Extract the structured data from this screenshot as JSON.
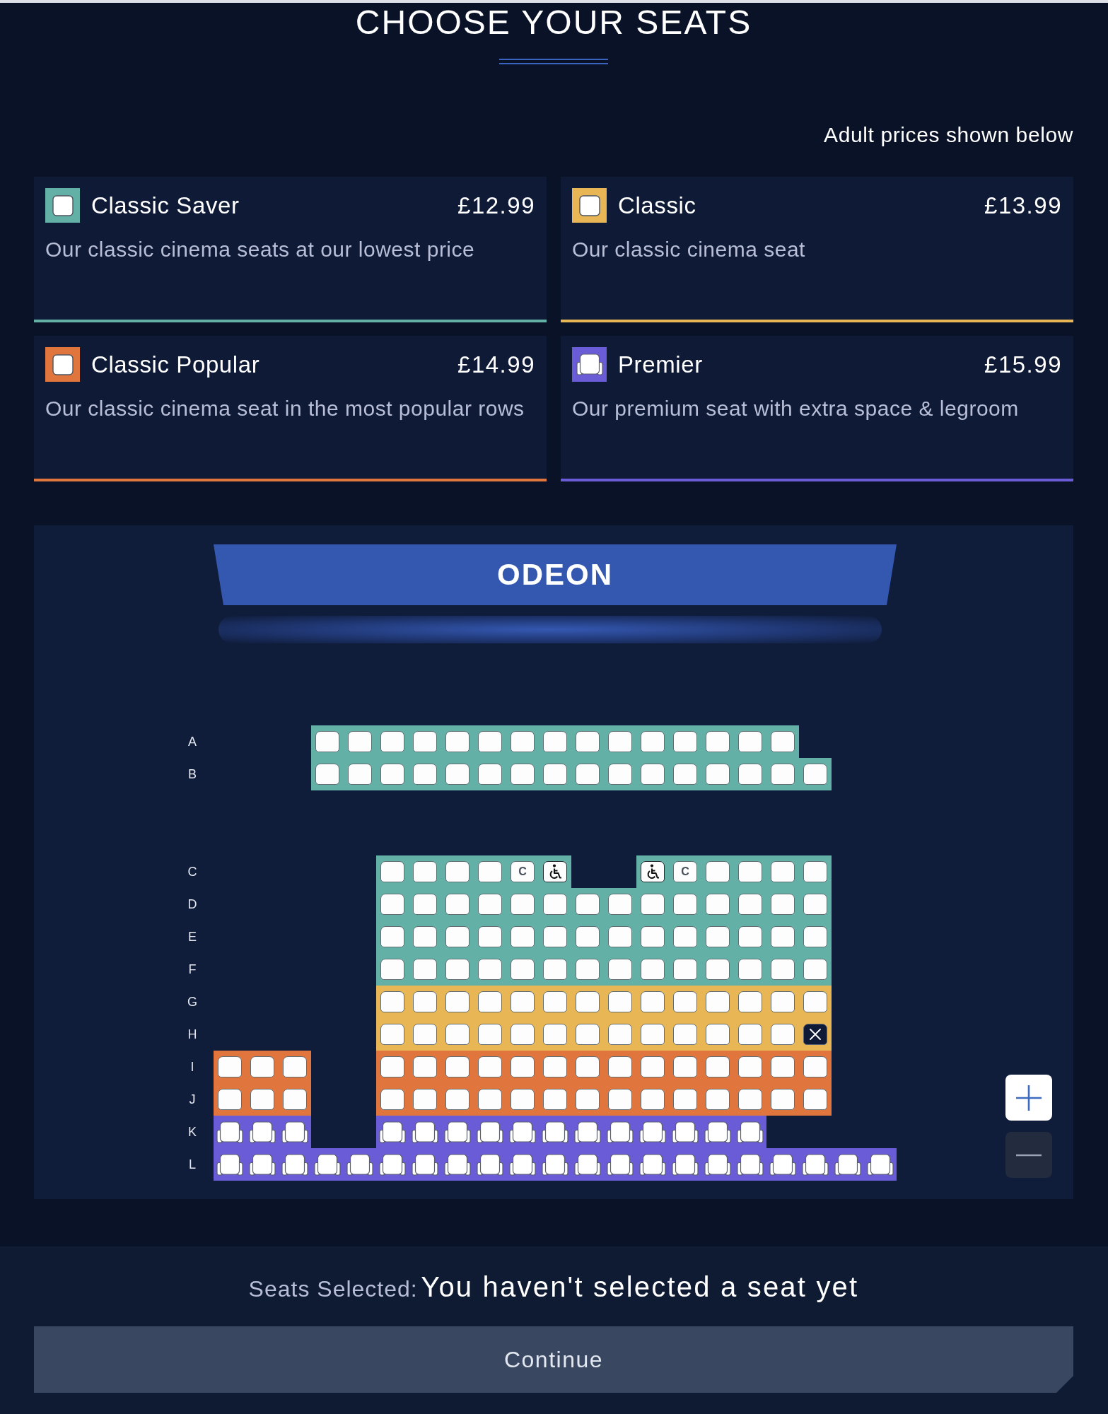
{
  "page": {
    "title": "CHOOSE YOUR SEATS",
    "price_note": "Adult prices shown below"
  },
  "tiers": [
    {
      "kind": "standard",
      "name": "Classic Saver",
      "price": "£12.99",
      "description": "Our classic cinema seats at our lowest price",
      "color": "#63b0a7"
    },
    {
      "kind": "standard",
      "name": "Classic",
      "price": "£13.99",
      "description": "Our classic cinema seat",
      "color": "#e8b654"
    },
    {
      "kind": "standard",
      "name": "Classic Popular",
      "price": "£14.99",
      "description": "Our classic cinema seat in the most popular rows",
      "color": "#e0763e"
    },
    {
      "kind": "premier",
      "name": "Premier",
      "price": "£15.99",
      "description": "Our premium seat with extra space & legroom",
      "color": "#6a5bd6"
    }
  ],
  "seat_map": {
    "screen": {
      "label": "ODEON"
    },
    "rows": [
      {
        "kind": "row",
        "label": "A",
        "color": "#63b0a7",
        "seats": [
          {
            "kind": "space"
          },
          {
            "kind": "space"
          },
          {
            "kind": "space"
          },
          {
            "kind": "standard",
            "selected": false
          },
          {
            "kind": "standard",
            "selected": false
          },
          {
            "kind": "standard",
            "selected": false
          },
          {
            "kind": "standard",
            "selected": false
          },
          {
            "kind": "standard",
            "selected": false
          },
          {
            "kind": "standard",
            "selected": false
          },
          {
            "kind": "standard",
            "selected": false
          },
          {
            "kind": "standard",
            "selected": false
          },
          {
            "kind": "standard",
            "selected": false
          },
          {
            "kind": "standard",
            "selected": false
          },
          {
            "kind": "standard",
            "selected": false
          },
          {
            "kind": "standard",
            "selected": false
          },
          {
            "kind": "standard",
            "selected": false
          },
          {
            "kind": "standard",
            "selected": false
          },
          {
            "kind": "standard",
            "selected": false
          }
        ]
      },
      {
        "kind": "row",
        "label": "B",
        "color": "#63b0a7",
        "seats": [
          {
            "kind": "space"
          },
          {
            "kind": "space"
          },
          {
            "kind": "space"
          },
          {
            "kind": "standard",
            "selected": false
          },
          {
            "kind": "standard",
            "selected": false
          },
          {
            "kind": "standard",
            "selected": false
          },
          {
            "kind": "standard",
            "selected": false
          },
          {
            "kind": "standard",
            "selected": false
          },
          {
            "kind": "standard",
            "selected": false
          },
          {
            "kind": "standard",
            "selected": false
          },
          {
            "kind": "standard",
            "selected": false
          },
          {
            "kind": "standard",
            "selected": false
          },
          {
            "kind": "standard",
            "selected": false
          },
          {
            "kind": "standard",
            "selected": false
          },
          {
            "kind": "standard",
            "selected": false
          },
          {
            "kind": "standard",
            "selected": false
          },
          {
            "kind": "standard",
            "selected": false
          },
          {
            "kind": "standard",
            "selected": false
          },
          {
            "kind": "standard",
            "selected": false
          }
        ]
      },
      {
        "kind": "aisle"
      },
      {
        "kind": "aisle"
      },
      {
        "kind": "row",
        "label": "C",
        "color": "#63b0a7",
        "seats": [
          {
            "kind": "space"
          },
          {
            "kind": "space"
          },
          {
            "kind": "space"
          },
          {
            "kind": "space"
          },
          {
            "kind": "space"
          },
          {
            "kind": "standard",
            "selected": false
          },
          {
            "kind": "standard",
            "selected": false
          },
          {
            "kind": "standard",
            "selected": false
          },
          {
            "kind": "standard",
            "selected": false
          },
          {
            "kind": "companion",
            "label": "C",
            "selected": false
          },
          {
            "kind": "wheelchair",
            "selected": false
          },
          {
            "kind": "space"
          },
          {
            "kind": "space"
          },
          {
            "kind": "wheelchair",
            "selected": false
          },
          {
            "kind": "companion",
            "label": "C",
            "selected": false
          },
          {
            "kind": "standard",
            "selected": false
          },
          {
            "kind": "standard",
            "selected": false
          },
          {
            "kind": "standard",
            "selected": false
          },
          {
            "kind": "standard",
            "selected": false
          }
        ]
      },
      {
        "kind": "row",
        "label": "D",
        "color": "#63b0a7",
        "seats": [
          {
            "kind": "space"
          },
          {
            "kind": "space"
          },
          {
            "kind": "space"
          },
          {
            "kind": "space"
          },
          {
            "kind": "space"
          },
          {
            "kind": "standard",
            "selected": false
          },
          {
            "kind": "standard",
            "selected": false
          },
          {
            "kind": "standard",
            "selected": false
          },
          {
            "kind": "standard",
            "selected": false
          },
          {
            "kind": "standard",
            "selected": false
          },
          {
            "kind": "standard",
            "selected": false
          },
          {
            "kind": "standard",
            "selected": false
          },
          {
            "kind": "standard",
            "selected": false
          },
          {
            "kind": "standard",
            "selected": false
          },
          {
            "kind": "standard",
            "selected": false
          },
          {
            "kind": "standard",
            "selected": false
          },
          {
            "kind": "standard",
            "selected": false
          },
          {
            "kind": "standard",
            "selected": false
          },
          {
            "kind": "standard",
            "selected": false
          }
        ]
      },
      {
        "kind": "row",
        "label": "E",
        "color": "#63b0a7",
        "seats": [
          {
            "kind": "space"
          },
          {
            "kind": "space"
          },
          {
            "kind": "space"
          },
          {
            "kind": "space"
          },
          {
            "kind": "space"
          },
          {
            "kind": "standard",
            "selected": false
          },
          {
            "kind": "standard",
            "selected": false
          },
          {
            "kind": "standard",
            "selected": false
          },
          {
            "kind": "standard",
            "selected": false
          },
          {
            "kind": "standard",
            "selected": false
          },
          {
            "kind": "standard",
            "selected": false
          },
          {
            "kind": "standard",
            "selected": false
          },
          {
            "kind": "standard",
            "selected": false
          },
          {
            "kind": "standard",
            "selected": false
          },
          {
            "kind": "standard",
            "selected": false
          },
          {
            "kind": "standard",
            "selected": false
          },
          {
            "kind": "standard",
            "selected": false
          },
          {
            "kind": "standard",
            "selected": false
          },
          {
            "kind": "standard",
            "selected": false
          }
        ]
      },
      {
        "kind": "row",
        "label": "F",
        "color": "#63b0a7",
        "seats": [
          {
            "kind": "space"
          },
          {
            "kind": "space"
          },
          {
            "kind": "space"
          },
          {
            "kind": "space"
          },
          {
            "kind": "space"
          },
          {
            "kind": "standard",
            "selected": false
          },
          {
            "kind": "standard",
            "selected": false
          },
          {
            "kind": "standard",
            "selected": false
          },
          {
            "kind": "standard",
            "selected": false
          },
          {
            "kind": "standard",
            "selected": false
          },
          {
            "kind": "standard",
            "selected": false
          },
          {
            "kind": "standard",
            "selected": false
          },
          {
            "kind": "standard",
            "selected": false
          },
          {
            "kind": "standard",
            "selected": false
          },
          {
            "kind": "standard",
            "selected": false
          },
          {
            "kind": "standard",
            "selected": false
          },
          {
            "kind": "standard",
            "selected": false
          },
          {
            "kind": "standard",
            "selected": false
          },
          {
            "kind": "standard",
            "selected": false
          }
        ]
      },
      {
        "kind": "row",
        "label": "G",
        "color": "#e8b654",
        "seats": [
          {
            "kind": "space"
          },
          {
            "kind": "space"
          },
          {
            "kind": "space"
          },
          {
            "kind": "space"
          },
          {
            "kind": "space"
          },
          {
            "kind": "standard",
            "selected": false
          },
          {
            "kind": "standard",
            "selected": false
          },
          {
            "kind": "standard",
            "selected": false
          },
          {
            "kind": "standard",
            "selected": false
          },
          {
            "kind": "standard",
            "selected": false
          },
          {
            "kind": "standard",
            "selected": false
          },
          {
            "kind": "standard",
            "selected": false
          },
          {
            "kind": "standard",
            "selected": false
          },
          {
            "kind": "standard",
            "selected": false
          },
          {
            "kind": "standard",
            "selected": false
          },
          {
            "kind": "standard",
            "selected": false
          },
          {
            "kind": "standard",
            "selected": false
          },
          {
            "kind": "standard",
            "selected": false
          },
          {
            "kind": "standard",
            "selected": false
          }
        ]
      },
      {
        "kind": "row",
        "label": "H",
        "color": "#e8b654",
        "seats": [
          {
            "kind": "space"
          },
          {
            "kind": "space"
          },
          {
            "kind": "space"
          },
          {
            "kind": "space"
          },
          {
            "kind": "space"
          },
          {
            "kind": "standard",
            "selected": false
          },
          {
            "kind": "standard",
            "selected": false
          },
          {
            "kind": "standard",
            "selected": false
          },
          {
            "kind": "standard",
            "selected": false
          },
          {
            "kind": "standard",
            "selected": false
          },
          {
            "kind": "standard",
            "selected": false
          },
          {
            "kind": "standard",
            "selected": false
          },
          {
            "kind": "standard",
            "selected": false
          },
          {
            "kind": "standard",
            "selected": false
          },
          {
            "kind": "standard",
            "selected": false
          },
          {
            "kind": "standard",
            "selected": false
          },
          {
            "kind": "standard",
            "selected": false
          },
          {
            "kind": "standard",
            "selected": false
          },
          {
            "kind": "unavailable",
            "selected": false
          }
        ]
      },
      {
        "kind": "row",
        "label": "I",
        "color": "#e0763e",
        "seats": [
          {
            "kind": "standard",
            "selected": false
          },
          {
            "kind": "standard",
            "selected": false
          },
          {
            "kind": "standard",
            "selected": false
          },
          {
            "kind": "space"
          },
          {
            "kind": "space"
          },
          {
            "kind": "standard",
            "selected": false
          },
          {
            "kind": "standard",
            "selected": false
          },
          {
            "kind": "standard",
            "selected": false
          },
          {
            "kind": "standard",
            "selected": false
          },
          {
            "kind": "standard",
            "selected": false
          },
          {
            "kind": "standard",
            "selected": false
          },
          {
            "kind": "standard",
            "selected": false
          },
          {
            "kind": "standard",
            "selected": false
          },
          {
            "kind": "standard",
            "selected": false
          },
          {
            "kind": "standard",
            "selected": false
          },
          {
            "kind": "standard",
            "selected": false
          },
          {
            "kind": "standard",
            "selected": false
          },
          {
            "kind": "standard",
            "selected": false
          },
          {
            "kind": "standard",
            "selected": false
          }
        ]
      },
      {
        "kind": "row",
        "label": "J",
        "color": "#e0763e",
        "seats": [
          {
            "kind": "standard",
            "selected": false
          },
          {
            "kind": "standard",
            "selected": false
          },
          {
            "kind": "standard",
            "selected": false
          },
          {
            "kind": "space"
          },
          {
            "kind": "space"
          },
          {
            "kind": "standard",
            "selected": false
          },
          {
            "kind": "standard",
            "selected": false
          },
          {
            "kind": "standard",
            "selected": false
          },
          {
            "kind": "standard",
            "selected": false
          },
          {
            "kind": "standard",
            "selected": false
          },
          {
            "kind": "standard",
            "selected": false
          },
          {
            "kind": "standard",
            "selected": false
          },
          {
            "kind": "standard",
            "selected": false
          },
          {
            "kind": "standard",
            "selected": false
          },
          {
            "kind": "standard",
            "selected": false
          },
          {
            "kind": "standard",
            "selected": false
          },
          {
            "kind": "standard",
            "selected": false
          },
          {
            "kind": "standard",
            "selected": false
          },
          {
            "kind": "standard",
            "selected": false
          }
        ]
      },
      {
        "kind": "row",
        "label": "K",
        "color": "#6a5bd6",
        "seats": [
          {
            "kind": "premier",
            "selected": false
          },
          {
            "kind": "premier",
            "selected": false
          },
          {
            "kind": "premier",
            "selected": false
          },
          {
            "kind": "space"
          },
          {
            "kind": "space"
          },
          {
            "kind": "premier",
            "selected": false
          },
          {
            "kind": "premier",
            "selected": false
          },
          {
            "kind": "premier",
            "selected": false
          },
          {
            "kind": "premier",
            "selected": false
          },
          {
            "kind": "premier",
            "selected": false
          },
          {
            "kind": "premier",
            "selected": false
          },
          {
            "kind": "premier",
            "selected": false
          },
          {
            "kind": "premier",
            "selected": false
          },
          {
            "kind": "premier",
            "selected": false
          },
          {
            "kind": "premier",
            "selected": false
          },
          {
            "kind": "premier",
            "selected": false
          },
          {
            "kind": "premier",
            "selected": false
          }
        ]
      },
      {
        "kind": "row",
        "label": "L",
        "color": "#6a5bd6",
        "seats": [
          {
            "kind": "premier",
            "selected": false
          },
          {
            "kind": "premier",
            "selected": false
          },
          {
            "kind": "premier",
            "selected": false
          },
          {
            "kind": "premier",
            "selected": false
          },
          {
            "kind": "premier",
            "selected": false
          },
          {
            "kind": "premier",
            "selected": false
          },
          {
            "kind": "premier",
            "selected": false
          },
          {
            "kind": "premier",
            "selected": false
          },
          {
            "kind": "premier",
            "selected": false
          },
          {
            "kind": "premier",
            "selected": false
          },
          {
            "kind": "premier",
            "selected": false
          },
          {
            "kind": "premier",
            "selected": false
          },
          {
            "kind": "premier",
            "selected": false
          },
          {
            "kind": "premier",
            "selected": false
          },
          {
            "kind": "premier",
            "selected": false
          },
          {
            "kind": "premier",
            "selected": false
          },
          {
            "kind": "premier",
            "selected": false
          },
          {
            "kind": "premier",
            "selected": false
          },
          {
            "kind": "premier",
            "selected": false
          },
          {
            "kind": "premier",
            "selected": false
          },
          {
            "kind": "premier",
            "selected": false
          }
        ]
      }
    ],
    "zoom_controls": [
      {
        "kind": "zoom-in",
        "disabled": false
      },
      {
        "kind": "zoom-out",
        "disabled": true
      }
    ]
  },
  "summary": {
    "label": "Seats Selected:",
    "value": "You haven't selected a seat yet"
  },
  "continue_button": {
    "label": "Continue",
    "disabled": true
  }
}
